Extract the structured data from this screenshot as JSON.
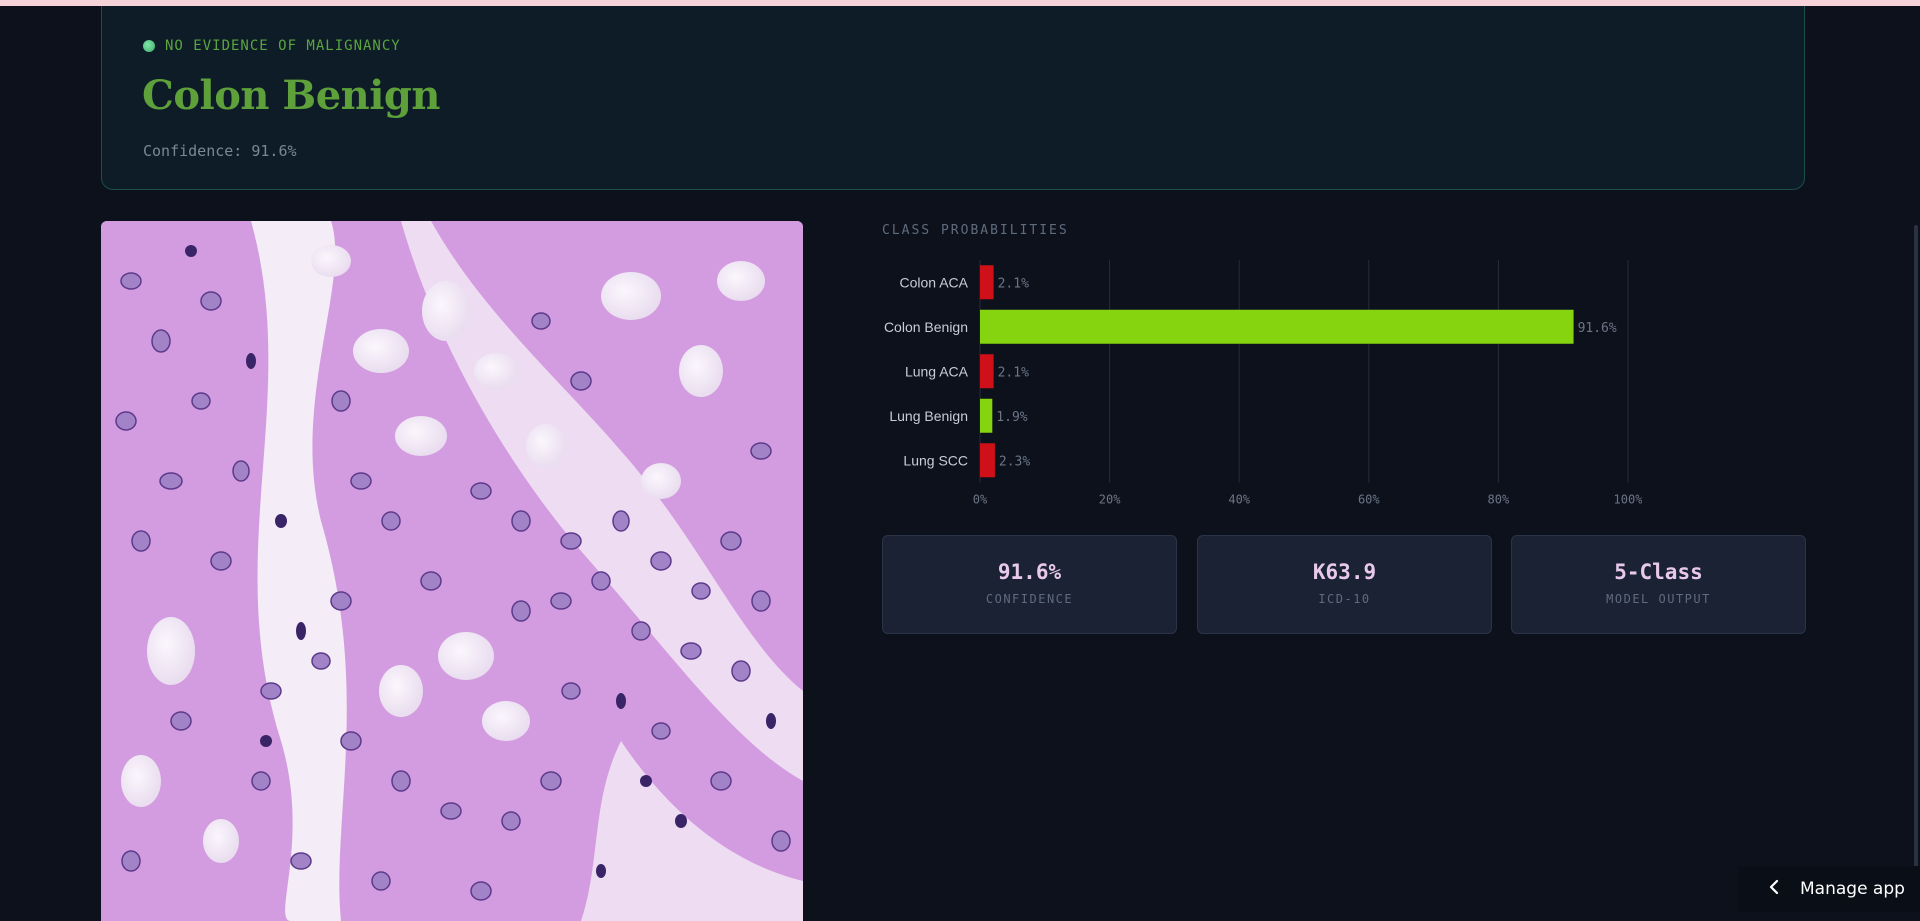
{
  "result": {
    "status": "NO EVIDENCE OF MALIGNANCY",
    "diagnosis": "Colon Benign",
    "confidence_text": "Confidence: 91.6%"
  },
  "probabilities_title": "CLASS PROBABILITIES",
  "chart_data": {
    "type": "bar",
    "orientation": "horizontal",
    "categories": [
      "Colon ACA",
      "Colon Benign",
      "Lung ACA",
      "Lung Benign",
      "Lung SCC"
    ],
    "values": [
      2.1,
      91.6,
      2.1,
      1.9,
      2.3
    ],
    "value_labels": [
      "2.1%",
      "91.6%",
      "2.1%",
      "1.9%",
      "2.3%"
    ],
    "bar_colors": [
      "#d01018",
      "#86d40f",
      "#d01018",
      "#86d40f",
      "#d01018"
    ],
    "xlim": [
      0,
      100
    ],
    "x_ticks": [
      "0%",
      "20%",
      "40%",
      "60%",
      "80%",
      "100%"
    ],
    "grid": true,
    "legend": false
  },
  "stats": [
    {
      "value": "91.6%",
      "label": "CONFIDENCE"
    },
    {
      "value": "K63.9",
      "label": "ICD-10"
    },
    {
      "value": "5-Class",
      "label": "MODEL OUTPUT"
    }
  ],
  "manage_app": {
    "icon": "chevron-left-icon",
    "label": "Manage app"
  },
  "colors": {
    "background": "#0d111c",
    "benign": "#86d40f",
    "malignant": "#d01018",
    "accent_green": "#5ea13a"
  }
}
